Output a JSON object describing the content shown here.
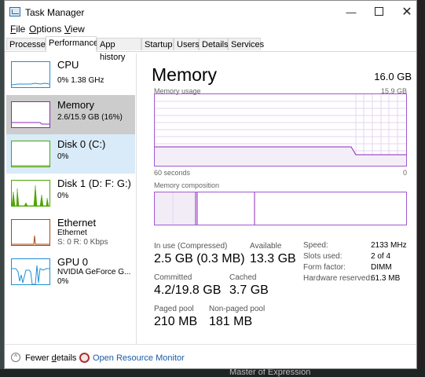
{
  "window": {
    "title": "Task Manager"
  },
  "title_buttons": {
    "minimize": "—",
    "close": "✕"
  },
  "menu": [
    {
      "label": "File",
      "accel": "F",
      "rest": "ile"
    },
    {
      "label": "Options",
      "accel": "O",
      "rest": "ptions"
    },
    {
      "label": "View",
      "accel": "V",
      "rest": "iew"
    }
  ],
  "tabs": [
    "Processes",
    "Performance",
    "App history",
    "Startup",
    "Users",
    "Details",
    "Services"
  ],
  "sidebar": {
    "items": [
      {
        "name": "CPU",
        "lines": [
          "0% 1.38 GHz"
        ]
      },
      {
        "name": "Memory",
        "lines": [
          "2.6/15.9 GB (16%)"
        ]
      },
      {
        "name": "Disk 0 (C:)",
        "lines": [
          "0%"
        ]
      },
      {
        "name": "Disk 1 (D: F: G:)",
        "lines": [
          "0%"
        ]
      },
      {
        "name": "Ethernet",
        "lines": [
          "Ethernet",
          "S: 0 R: 0 Kbps"
        ]
      },
      {
        "name": "GPU 0",
        "lines": [
          "NVIDIA GeForce G...",
          "0%"
        ]
      }
    ]
  },
  "main": {
    "title": "Memory",
    "total": "16.0 GB",
    "usage_label": "Memory usage",
    "usage_max": "15.9 GB",
    "time_left": "60 seconds",
    "time_right": "0",
    "composition_label": "Memory composition",
    "stats": {
      "in_use_label": "In use (Compressed)",
      "in_use_value": "2.5 GB (0.3 MB)",
      "available_label": "Available",
      "available_value": "13.3 GB",
      "committed_label": "Committed",
      "committed_value": "4.2/19.8 GB",
      "cached_label": "Cached",
      "cached_value": "3.7 GB",
      "paged_label": "Paged pool",
      "paged_value": "210 MB",
      "nonpaged_label": "Non-paged pool",
      "nonpaged_value": "181 MB"
    },
    "details": [
      {
        "label": "Speed:",
        "value": "2133 MHz"
      },
      {
        "label": "Slots used:",
        "value": "2 of 4"
      },
      {
        "label": "Form factor:",
        "value": "DIMM"
      },
      {
        "label": "Hardware reserved:",
        "value": "61.3 MB"
      }
    ]
  },
  "footer": {
    "fewer_details_accel": "d",
    "fewer_details_pre": "Fewer ",
    "fewer_details_post": "etails",
    "resource_monitor": "Open Resource Monitor"
  },
  "background": {
    "caption": "Master of Expression"
  },
  "colors": {
    "cpu": "#1f8fd6",
    "memory": "#8b29b9",
    "disk": "#4da600",
    "ethernet": "#a84a10",
    "gpu": "#1f8fd6"
  }
}
